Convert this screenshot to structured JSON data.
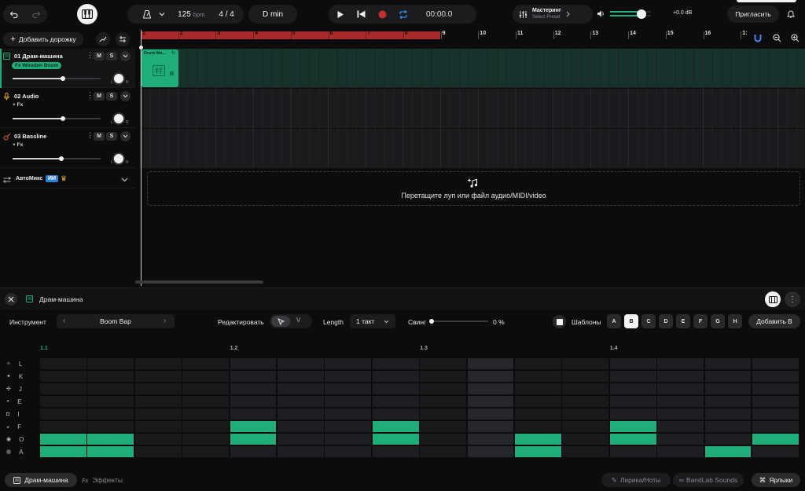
{
  "topbar": {
    "tempo": "125",
    "tempo_unit": "bpm",
    "time_sig": "4 / 4",
    "key": "D min",
    "time": "00:00.0",
    "mastering_title": "Мастеринг",
    "mastering_preset": "Select Preset",
    "volume_db": "+0.0 dB",
    "invite_label": "Пригласить"
  },
  "tracks_panel": {
    "add_track_label": "Добавить дорожку",
    "tracks": [
      {
        "name": "01  Драм-машина",
        "fx_label": "Fx  Wooden Boom",
        "mute": "M",
        "solo": "S",
        "volume": 0.57
      },
      {
        "name": "02  Audio",
        "fx_label": "+ Fx",
        "mute": "M",
        "solo": "S",
        "volume": 0.57
      },
      {
        "name": "03  Bassline",
        "fx_label": "+ Fx",
        "mute": "M",
        "solo": "S",
        "volume": 0.55
      }
    ],
    "automix_label": "АвтоМикс",
    "automix_badge": "ИИ"
  },
  "ruler": {
    "bars": [
      "1",
      "2",
      "3",
      "4",
      "5",
      "6",
      "7",
      "8",
      "9",
      "10",
      "11",
      "12",
      "13",
      "14",
      "15",
      "16",
      "1:"
    ]
  },
  "clip": {
    "title": "Drum Ma...",
    "pattern": "B"
  },
  "dropzone": {
    "text": "Перетащите луп или файл аудио/MIDI/video"
  },
  "drum_editor": {
    "title": "Драм-машина",
    "instrument_label": "Инструмент",
    "instrument_value": "Boom Bap",
    "edit_label": "Редактировать",
    "edit_mode_v": "V",
    "length_label": "Length",
    "length_value": "1 такт",
    "swing_label": "Свинг",
    "swing_value": "0 %",
    "swing_amount": 0,
    "templates_label": "Шаблоны",
    "patterns": [
      "A",
      "B",
      "C",
      "D",
      "E",
      "F",
      "G",
      "H"
    ],
    "selected_pattern": "B",
    "add_button": "Добавить B",
    "beat_labels": [
      "1.1",
      "1.2",
      "1.3",
      "1.4"
    ],
    "rows": [
      "L",
      "K",
      "J",
      "E",
      "I",
      "F",
      "O",
      "A"
    ],
    "steps": {
      "L": [],
      "K": [],
      "J": [],
      "E": [],
      "I": [],
      "F": [
        4,
        7,
        12
      ],
      "O": [
        0,
        1,
        4,
        7,
        10,
        12,
        15
      ],
      "A": [
        0,
        1,
        10,
        14
      ]
    }
  },
  "footer": {
    "tab_drum": "Драм-машина",
    "tab_effects": "Эффекты",
    "lyrics": "Лирика/Ноты",
    "sounds": "BandLab Sounds",
    "shortcuts": "Ярлыки"
  },
  "colors": {
    "accent_green": "#1fae7a",
    "loop_red": "#a92a2a",
    "automix_blue": "#2e7fd8"
  }
}
